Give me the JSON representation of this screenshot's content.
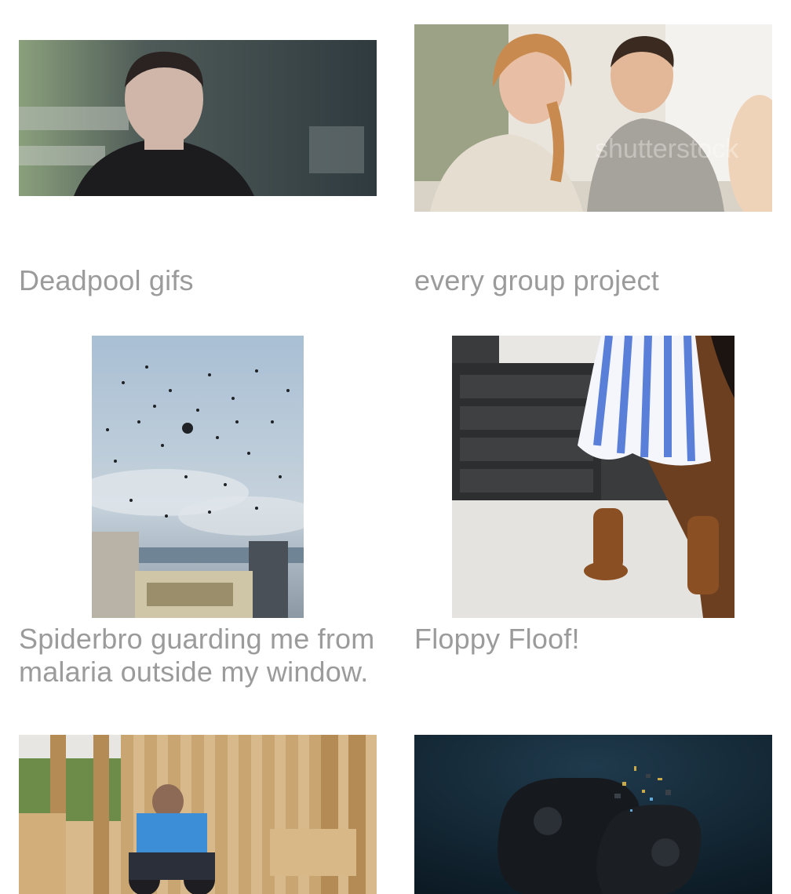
{
  "feed": {
    "items": [
      {
        "title": "Deadpool gifs",
        "image_icon": "gif-thumbnail"
      },
      {
        "title": "every group project",
        "image_icon": "gif-thumbnail",
        "watermark": "shutterstock"
      },
      {
        "title": "Spiderbro guarding me from malaria outside my window.",
        "image_icon": "photo-thumbnail"
      },
      {
        "title": "Floppy Floof!",
        "image_icon": "gif-thumbnail"
      },
      {
        "title": "",
        "image_icon": "photo-thumbnail"
      },
      {
        "title": "",
        "image_icon": "photo-thumbnail"
      }
    ]
  },
  "colors": {
    "background": "#ffffff",
    "caption_text": "#9b9b9b"
  }
}
